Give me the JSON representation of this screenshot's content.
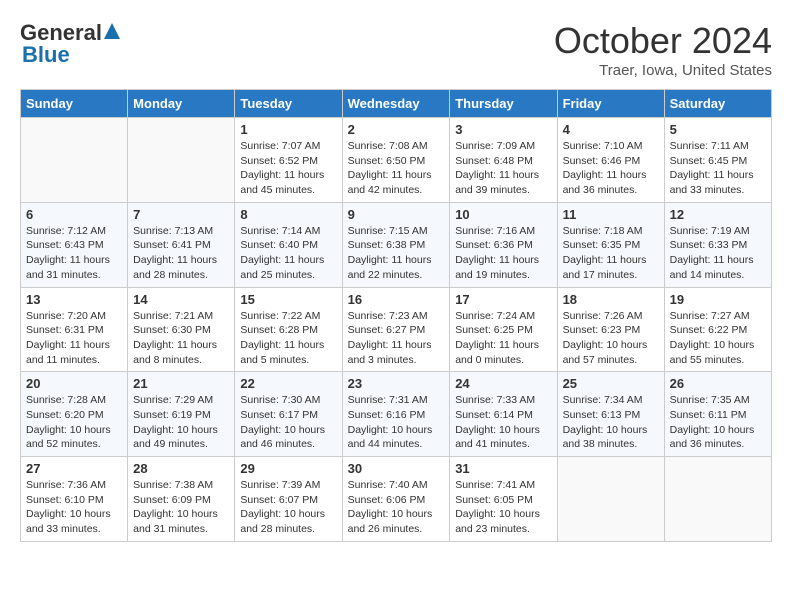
{
  "logo": {
    "general": "General",
    "blue": "Blue"
  },
  "title": "October 2024",
  "location": "Traer, Iowa, United States",
  "days_of_week": [
    "Sunday",
    "Monday",
    "Tuesday",
    "Wednesday",
    "Thursday",
    "Friday",
    "Saturday"
  ],
  "weeks": [
    [
      {
        "day": "",
        "sunrise": "",
        "sunset": "",
        "daylight": ""
      },
      {
        "day": "",
        "sunrise": "",
        "sunset": "",
        "daylight": ""
      },
      {
        "day": "1",
        "sunrise": "Sunrise: 7:07 AM",
        "sunset": "Sunset: 6:52 PM",
        "daylight": "Daylight: 11 hours and 45 minutes."
      },
      {
        "day": "2",
        "sunrise": "Sunrise: 7:08 AM",
        "sunset": "Sunset: 6:50 PM",
        "daylight": "Daylight: 11 hours and 42 minutes."
      },
      {
        "day": "3",
        "sunrise": "Sunrise: 7:09 AM",
        "sunset": "Sunset: 6:48 PM",
        "daylight": "Daylight: 11 hours and 39 minutes."
      },
      {
        "day": "4",
        "sunrise": "Sunrise: 7:10 AM",
        "sunset": "Sunset: 6:46 PM",
        "daylight": "Daylight: 11 hours and 36 minutes."
      },
      {
        "day": "5",
        "sunrise": "Sunrise: 7:11 AM",
        "sunset": "Sunset: 6:45 PM",
        "daylight": "Daylight: 11 hours and 33 minutes."
      }
    ],
    [
      {
        "day": "6",
        "sunrise": "Sunrise: 7:12 AM",
        "sunset": "Sunset: 6:43 PM",
        "daylight": "Daylight: 11 hours and 31 minutes."
      },
      {
        "day": "7",
        "sunrise": "Sunrise: 7:13 AM",
        "sunset": "Sunset: 6:41 PM",
        "daylight": "Daylight: 11 hours and 28 minutes."
      },
      {
        "day": "8",
        "sunrise": "Sunrise: 7:14 AM",
        "sunset": "Sunset: 6:40 PM",
        "daylight": "Daylight: 11 hours and 25 minutes."
      },
      {
        "day": "9",
        "sunrise": "Sunrise: 7:15 AM",
        "sunset": "Sunset: 6:38 PM",
        "daylight": "Daylight: 11 hours and 22 minutes."
      },
      {
        "day": "10",
        "sunrise": "Sunrise: 7:16 AM",
        "sunset": "Sunset: 6:36 PM",
        "daylight": "Daylight: 11 hours and 19 minutes."
      },
      {
        "day": "11",
        "sunrise": "Sunrise: 7:18 AM",
        "sunset": "Sunset: 6:35 PM",
        "daylight": "Daylight: 11 hours and 17 minutes."
      },
      {
        "day": "12",
        "sunrise": "Sunrise: 7:19 AM",
        "sunset": "Sunset: 6:33 PM",
        "daylight": "Daylight: 11 hours and 14 minutes."
      }
    ],
    [
      {
        "day": "13",
        "sunrise": "Sunrise: 7:20 AM",
        "sunset": "Sunset: 6:31 PM",
        "daylight": "Daylight: 11 hours and 11 minutes."
      },
      {
        "day": "14",
        "sunrise": "Sunrise: 7:21 AM",
        "sunset": "Sunset: 6:30 PM",
        "daylight": "Daylight: 11 hours and 8 minutes."
      },
      {
        "day": "15",
        "sunrise": "Sunrise: 7:22 AM",
        "sunset": "Sunset: 6:28 PM",
        "daylight": "Daylight: 11 hours and 5 minutes."
      },
      {
        "day": "16",
        "sunrise": "Sunrise: 7:23 AM",
        "sunset": "Sunset: 6:27 PM",
        "daylight": "Daylight: 11 hours and 3 minutes."
      },
      {
        "day": "17",
        "sunrise": "Sunrise: 7:24 AM",
        "sunset": "Sunset: 6:25 PM",
        "daylight": "Daylight: 11 hours and 0 minutes."
      },
      {
        "day": "18",
        "sunrise": "Sunrise: 7:26 AM",
        "sunset": "Sunset: 6:23 PM",
        "daylight": "Daylight: 10 hours and 57 minutes."
      },
      {
        "day": "19",
        "sunrise": "Sunrise: 7:27 AM",
        "sunset": "Sunset: 6:22 PM",
        "daylight": "Daylight: 10 hours and 55 minutes."
      }
    ],
    [
      {
        "day": "20",
        "sunrise": "Sunrise: 7:28 AM",
        "sunset": "Sunset: 6:20 PM",
        "daylight": "Daylight: 10 hours and 52 minutes."
      },
      {
        "day": "21",
        "sunrise": "Sunrise: 7:29 AM",
        "sunset": "Sunset: 6:19 PM",
        "daylight": "Daylight: 10 hours and 49 minutes."
      },
      {
        "day": "22",
        "sunrise": "Sunrise: 7:30 AM",
        "sunset": "Sunset: 6:17 PM",
        "daylight": "Daylight: 10 hours and 46 minutes."
      },
      {
        "day": "23",
        "sunrise": "Sunrise: 7:31 AM",
        "sunset": "Sunset: 6:16 PM",
        "daylight": "Daylight: 10 hours and 44 minutes."
      },
      {
        "day": "24",
        "sunrise": "Sunrise: 7:33 AM",
        "sunset": "Sunset: 6:14 PM",
        "daylight": "Daylight: 10 hours and 41 minutes."
      },
      {
        "day": "25",
        "sunrise": "Sunrise: 7:34 AM",
        "sunset": "Sunset: 6:13 PM",
        "daylight": "Daylight: 10 hours and 38 minutes."
      },
      {
        "day": "26",
        "sunrise": "Sunrise: 7:35 AM",
        "sunset": "Sunset: 6:11 PM",
        "daylight": "Daylight: 10 hours and 36 minutes."
      }
    ],
    [
      {
        "day": "27",
        "sunrise": "Sunrise: 7:36 AM",
        "sunset": "Sunset: 6:10 PM",
        "daylight": "Daylight: 10 hours and 33 minutes."
      },
      {
        "day": "28",
        "sunrise": "Sunrise: 7:38 AM",
        "sunset": "Sunset: 6:09 PM",
        "daylight": "Daylight: 10 hours and 31 minutes."
      },
      {
        "day": "29",
        "sunrise": "Sunrise: 7:39 AM",
        "sunset": "Sunset: 6:07 PM",
        "daylight": "Daylight: 10 hours and 28 minutes."
      },
      {
        "day": "30",
        "sunrise": "Sunrise: 7:40 AM",
        "sunset": "Sunset: 6:06 PM",
        "daylight": "Daylight: 10 hours and 26 minutes."
      },
      {
        "day": "31",
        "sunrise": "Sunrise: 7:41 AM",
        "sunset": "Sunset: 6:05 PM",
        "daylight": "Daylight: 10 hours and 23 minutes."
      },
      {
        "day": "",
        "sunrise": "",
        "sunset": "",
        "daylight": ""
      },
      {
        "day": "",
        "sunrise": "",
        "sunset": "",
        "daylight": ""
      }
    ]
  ]
}
